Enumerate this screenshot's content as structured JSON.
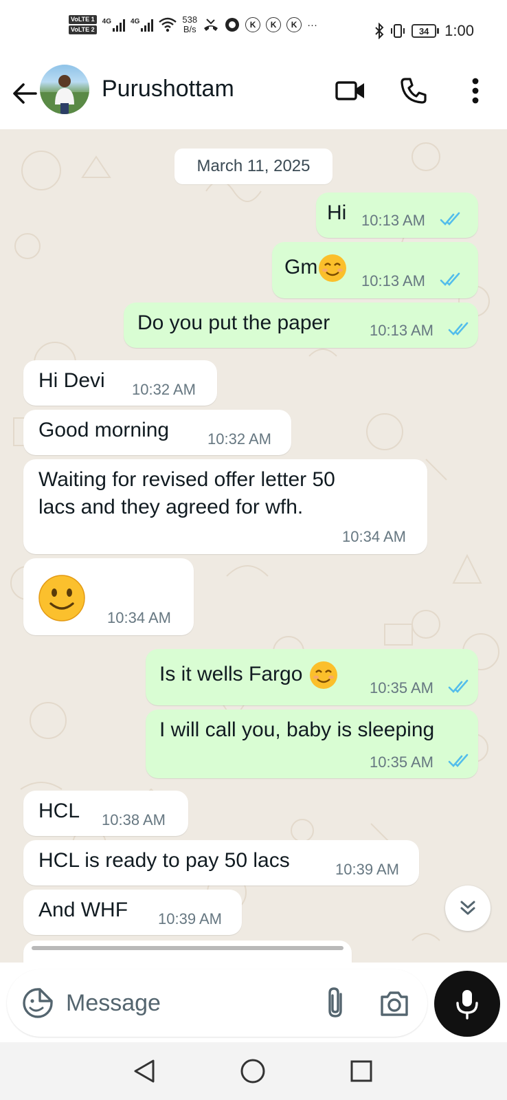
{
  "status_bar": {
    "sim1_label": "VoLTE 1",
    "sim2_label": "VoLTE 2",
    "net1": "4G",
    "net2": "4G",
    "net_speed_value": "538",
    "net_speed_unit": "B/s",
    "notif_k1": "K",
    "notif_k2": "K",
    "notif_k3": "K",
    "more_dots": "···",
    "battery": "34",
    "time": "1:00"
  },
  "header": {
    "contact_name": "Purushottam"
  },
  "chat": {
    "date": "March 11, 2025",
    "messages": [
      {
        "dir": "out",
        "text": "Hi",
        "time": "10:13 AM"
      },
      {
        "dir": "out",
        "text": "Gm",
        "time": "10:13 AM"
      },
      {
        "dir": "out",
        "text": "Do you put the paper",
        "time": "10:13 AM"
      },
      {
        "dir": "in",
        "text": "Hi Devi",
        "time": "10:32 AM"
      },
      {
        "dir": "in",
        "text": "Good morning",
        "time": "10:32 AM"
      },
      {
        "dir": "in",
        "text_line1": "Waiting for revised offer letter 50",
        "text_line2": "lacs and they agreed for wfh.",
        "time": "10:34 AM"
      },
      {
        "dir": "in",
        "text": "",
        "time": "10:34 AM"
      },
      {
        "dir": "out",
        "text": "Is it wells Fargo",
        "time": "10:35 AM"
      },
      {
        "dir": "out",
        "text": "I will call you, baby is sleeping",
        "time": "10:35 AM"
      },
      {
        "dir": "in",
        "text": "HCL",
        "time": "10:38 AM"
      },
      {
        "dir": "in",
        "text": "HCL is ready to pay 50 lacs",
        "time": "10:39 AM"
      },
      {
        "dir": "in",
        "text": "And WHF",
        "time": "10:39 AM"
      }
    ]
  },
  "input": {
    "placeholder": "Message"
  },
  "colors": {
    "outgoing_bubble": "#d9fdd3",
    "incoming_bubble": "#ffffff",
    "chat_background": "#efeae2",
    "read_ticks": "#53bdeb"
  },
  "icons": {
    "back": "arrow-left-icon",
    "video": "video-call-icon",
    "phone": "phone-icon",
    "menu": "more-vert-icon",
    "sticker": "sticker-icon",
    "attach": "paperclip-icon",
    "camera": "camera-icon",
    "mic": "mic-icon",
    "scroll": "double-chevron-down-icon",
    "nav_back": "triangle-back-icon",
    "nav_home": "circle-home-icon",
    "nav_recents": "square-recents-icon"
  }
}
